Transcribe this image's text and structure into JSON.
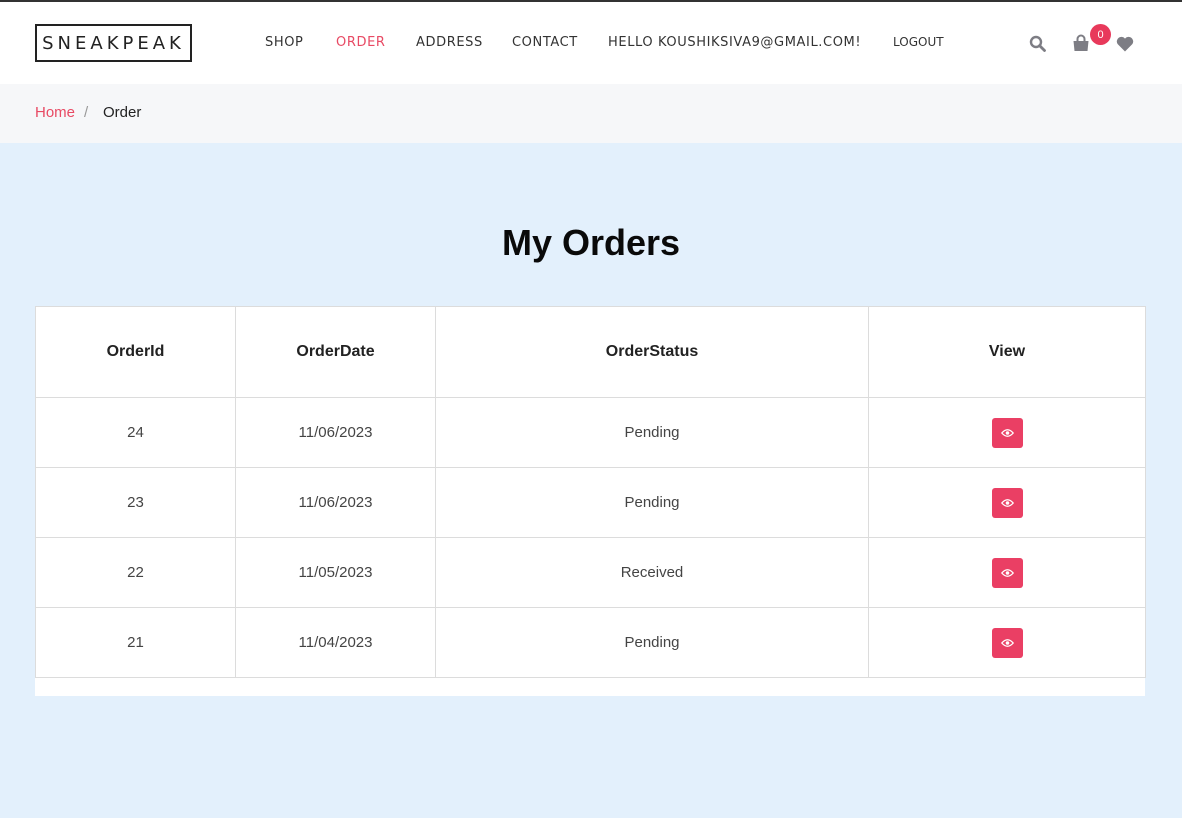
{
  "brand": {
    "logo_text": "SNEAKPEAK"
  },
  "nav": {
    "shop": "SHOP",
    "order": "ORDER",
    "address": "ADDRESS",
    "contact": "CONTACT",
    "greeting": "HELLO KOUSHIKSIVA9@GMAIL.COM!",
    "logout": "LOGOUT"
  },
  "header_icons": {
    "search": "search-icon",
    "cart": "shopping-bag-icon",
    "cart_count": "0",
    "wishlist": "heart-icon"
  },
  "breadcrumb": {
    "home": "Home",
    "separator": "/",
    "current": "Order"
  },
  "page": {
    "title": "My Orders"
  },
  "orders_table": {
    "headers": [
      "OrderId",
      "OrderDate",
      "OrderStatus",
      "View"
    ],
    "rows": [
      {
        "id": "24",
        "date": "11/06/2023",
        "status": "Pending"
      },
      {
        "id": "23",
        "date": "11/06/2023",
        "status": "Pending"
      },
      {
        "id": "22",
        "date": "11/05/2023",
        "status": "Received"
      },
      {
        "id": "21",
        "date": "11/04/2023",
        "status": "Pending"
      }
    ],
    "view_icon": "eye-icon"
  },
  "colors": {
    "accent": "#e84a64",
    "button": "#ea3f64",
    "page_background": "#e3f0fc",
    "icon_gray": "#7d7d84"
  }
}
